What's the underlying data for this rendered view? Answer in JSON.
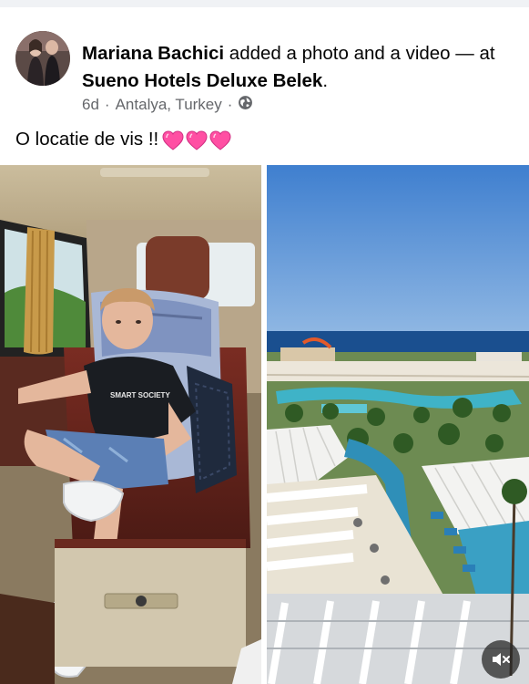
{
  "post": {
    "author_name": "Mariana Bachici",
    "action_text": " added a photo and a video — at ",
    "location_name": "Sueno Hotels Deluxe Belek",
    "period": ".",
    "time": "6d",
    "sep1": "·",
    "place": "Antalya, Turkey",
    "sep2": "·",
    "privacy_icon": "globe-icon",
    "caption_text": "O locatie de vis !!",
    "caption_emoji": [
      "heart-icon",
      "heart-icon",
      "heart-icon"
    ],
    "shirt_text": "SMART SOCIETY"
  },
  "media": {
    "left": "photo",
    "right": "video",
    "mute_icon": "volume-muted-icon"
  },
  "colors": {
    "text": "#050505",
    "meta": "#65676b",
    "heart": "#ff4fa3",
    "sky": "#3f7fcf",
    "sea": "#1a4f8f"
  }
}
